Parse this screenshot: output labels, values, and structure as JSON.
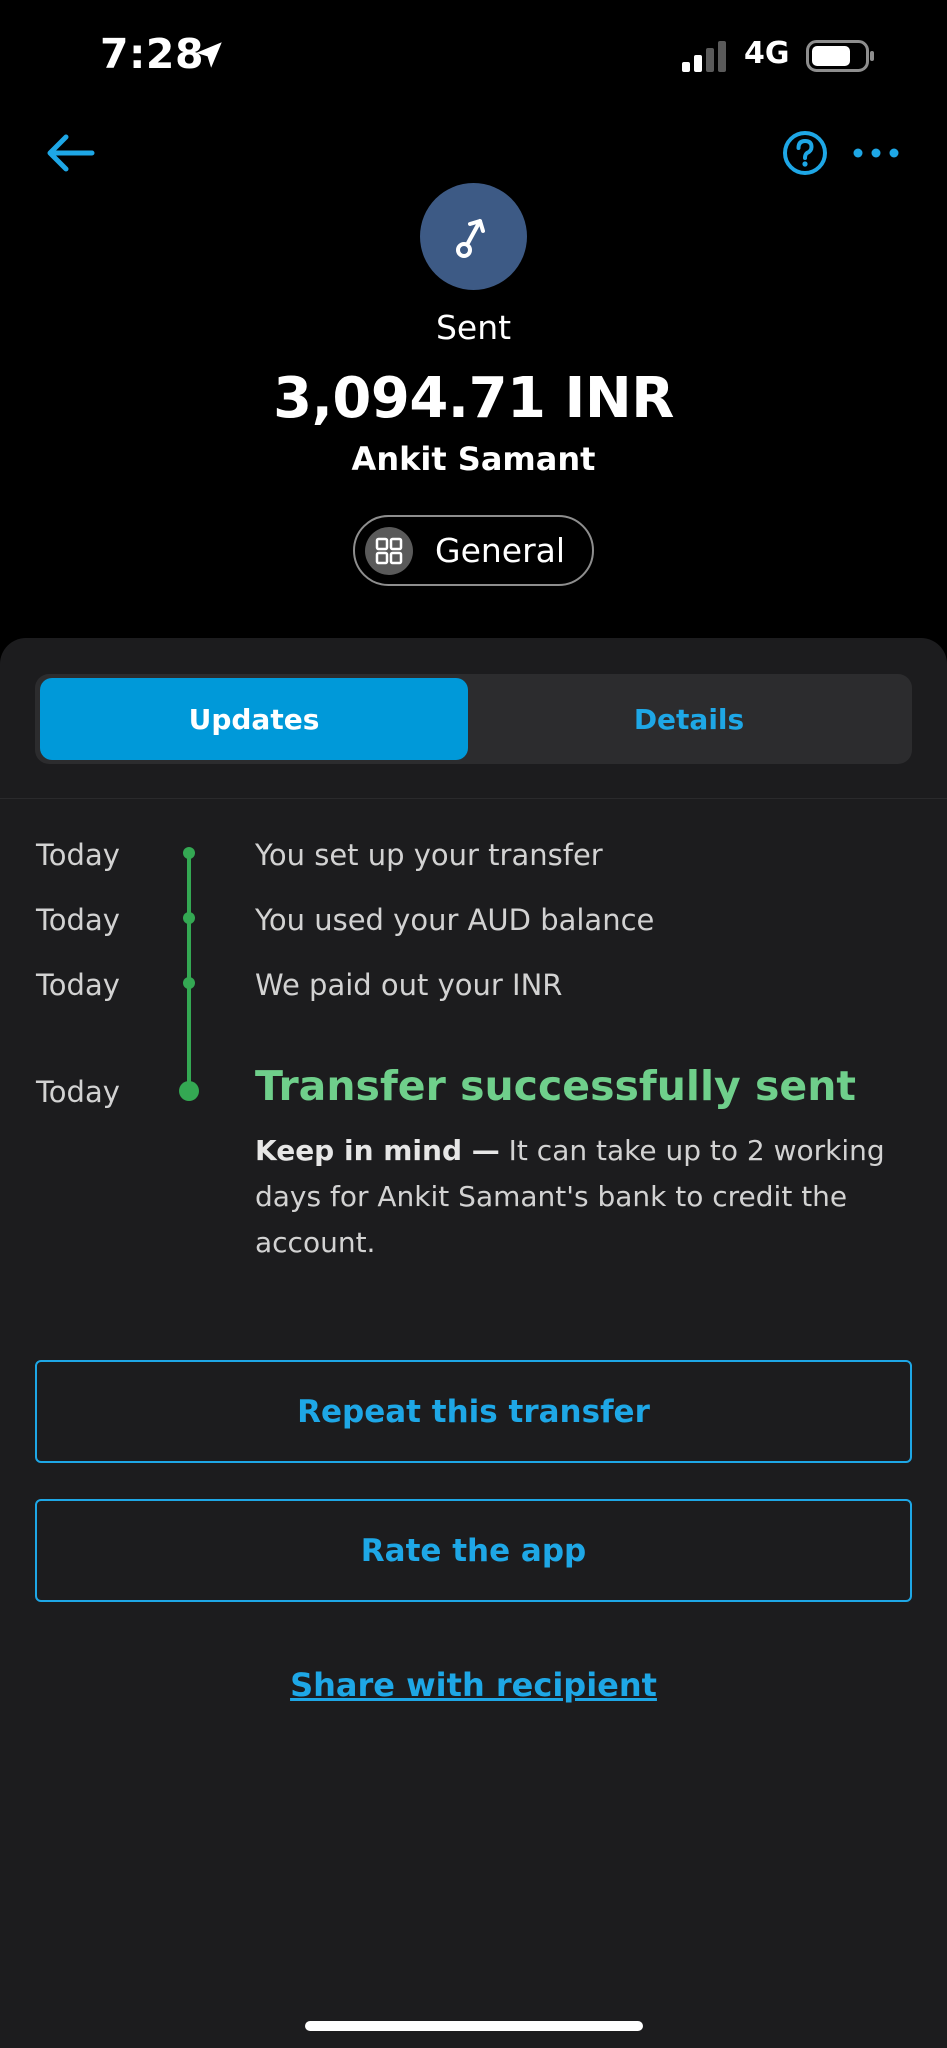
{
  "status_bar": {
    "time": "7:28",
    "network": "4G",
    "icons": [
      "location-arrow-icon",
      "signal-icon",
      "battery-icon"
    ]
  },
  "header": {
    "icons": [
      "back-arrow-icon",
      "help-icon",
      "more-icon"
    ],
    "status_label": "Sent",
    "amount": "3,094.71 INR",
    "recipient": "Ankit Samant",
    "category": "General",
    "avatar_color": "#3d5a85"
  },
  "tabs": [
    {
      "label": "Updates",
      "active": true
    },
    {
      "label": "Details",
      "active": false
    }
  ],
  "timeline": [
    {
      "date": "Today",
      "text": "You set up your transfer"
    },
    {
      "date": "Today",
      "text": "You used your AUD balance"
    },
    {
      "date": "Today",
      "text": "We paid out your INR"
    },
    {
      "date": "Today",
      "text": "Transfer successfully sent"
    }
  ],
  "note": {
    "bold": "Keep in mind —",
    "text": " It can take up to 2 working days for Ankit Samant's bank to credit the account."
  },
  "actions": {
    "repeat": "Repeat this transfer",
    "rate": "Rate the app",
    "share": "Share with recipient"
  },
  "colors": {
    "accent": "#1ea7e6",
    "active_tab": "#0099d9",
    "success": "#6fcf8b",
    "timeline": "#34a853",
    "card_bg": "#1c1c1e"
  }
}
